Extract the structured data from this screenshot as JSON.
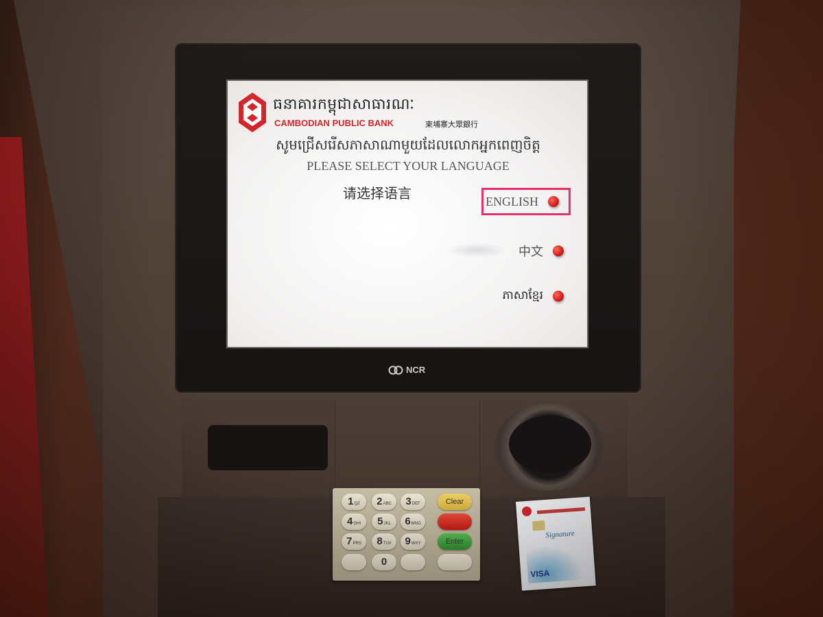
{
  "screen": {
    "bank_name_khmer": "ធនាគារកម្ពុជាសាធារណៈ",
    "bank_name_english": "CAMBODIAN PUBLIC BANK",
    "bank_name_chinese": "柬埔寨大眾銀行",
    "prompt_khmer": "សូមជ្រើសរើសភាសាណាមួយដែលលោកអ្នកពេញចិត្ត",
    "prompt_english": "PLEASE SELECT YOUR LANGUAGE",
    "prompt_chinese": "请选择语言",
    "languages": [
      {
        "label": "ENGLISH",
        "highlighted": true
      },
      {
        "label": "中文",
        "highlighted": false
      },
      {
        "label": "ភាសាខ្មែរ",
        "highlighted": false
      }
    ],
    "highlight_color": "#e62e6b",
    "brand_color": "#d4262a"
  },
  "machine": {
    "brand": "NCR"
  },
  "keypad": {
    "keys": [
      {
        "num": "1",
        "sub": "QZ"
      },
      {
        "num": "2",
        "sub": "ABC"
      },
      {
        "num": "3",
        "sub": "DEF"
      },
      {
        "num": "4",
        "sub": "GHI"
      },
      {
        "num": "5",
        "sub": "JKL"
      },
      {
        "num": "6",
        "sub": "MNO"
      },
      {
        "num": "7",
        "sub": "PRS"
      },
      {
        "num": "8",
        "sub": "TUV"
      },
      {
        "num": "9",
        "sub": "WXY"
      },
      {
        "num": "",
        "sub": ""
      },
      {
        "num": "0",
        "sub": ""
      },
      {
        "num": "",
        "sub": ""
      }
    ],
    "clear_label": "Clear",
    "cancel_label": "",
    "enter_label": "Enter",
    "blank_label": "",
    "clear_color": "#e8c24a",
    "cancel_color": "#d8261f",
    "enter_color": "#3aa63a"
  },
  "sticker": {
    "signature": "Signature",
    "network": "VISA"
  }
}
